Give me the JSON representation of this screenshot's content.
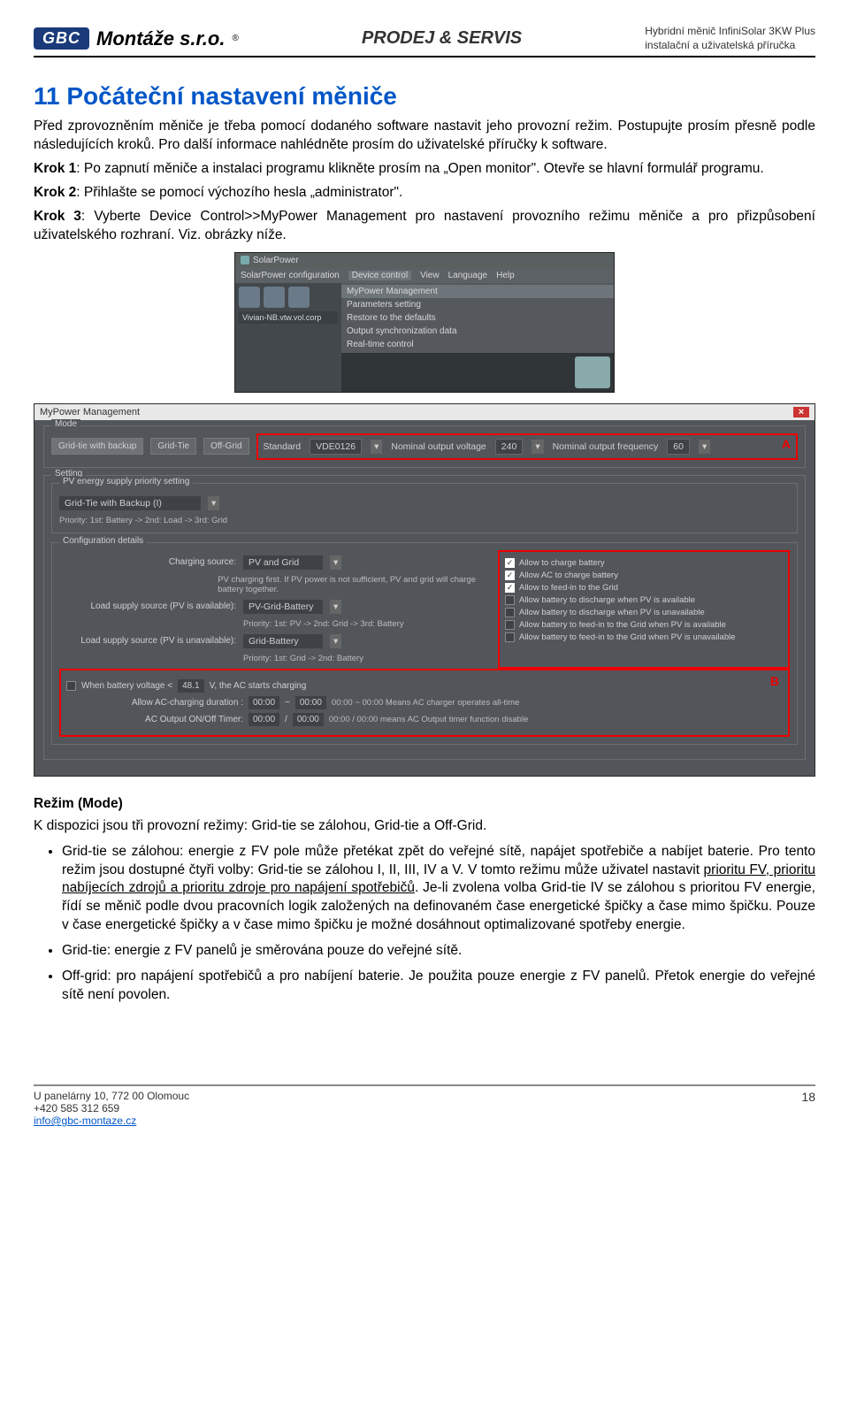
{
  "header": {
    "logo": "GBC",
    "company": "Montáže s.r.o.",
    "reg": "®",
    "mid": "PRODEJ & SERVIS",
    "right1": "Hybridní měnič InfiniSolar 3KW Plus",
    "right2": "instalační a uživatelská příručka"
  },
  "title": "11 Počáteční nastavení měniče",
  "intro": "Před zprovozněním měniče je třeba pomocí dodaného software nastavit jeho provozní režim. Postupujte prosím přesně podle následujících kroků. Pro další informace nahlédněte prosím do uživatelské příručky k software.",
  "krok1_b": "Krok 1",
  "krok1": ": Po zapnutí měniče a instalaci programu klikněte prosím na „Open monitor\". Otevře se hlavní formulář programu.",
  "krok2_b": "Krok 2",
  "krok2": ": Přihlašte se pomocí výchozího hesla „administrator\".",
  "krok3_b": "Krok 3",
  "krok3": ": Vyberte Device Control>>MyPower Management pro nastavení provozního režimu měniče a pro přizpůsobení uživatelského rozhraní. Viz. obrázky níže.",
  "ss1": {
    "appname": "SolarPower",
    "menu": [
      "SolarPower configuration",
      "Device control",
      "View",
      "Language",
      "Help"
    ],
    "treeitem": "Vivian-NB.vtw.vol.corp",
    "submenu": [
      "MyPower Management",
      "Parameters setting",
      "Restore to the defaults",
      "Output synchronization data",
      "Real-time control"
    ]
  },
  "ss2": {
    "winTitle": "MyPower Management",
    "mode": "Mode",
    "tabs": [
      "Grid-tie with backup",
      "Grid-Tie",
      "Off-Grid"
    ],
    "standard": "Standard",
    "standardVal": "VDE0126",
    "nov": "Nominal output voltage",
    "novVal": "240",
    "nof": "Nominal output frequency",
    "nofVal": "60",
    "letterA": "A",
    "setting": "Setting",
    "pvGroup": "PV energy supply priority setting",
    "pvOption": "Grid-Tie with Backup (I)",
    "pvPriority": "Priority: 1st: Battery -> 2nd: Load -> 3rd: Grid",
    "cfgGroup": "Configuration details",
    "chargingSource": "Charging source:",
    "chargingSourceVal": "PV and Grid",
    "chargingNote": "PV charging first. If PV power is not sufficient, PV and grid will charge battery together.",
    "loadAvail": "Load supply source (PV is available):",
    "loadAvailVal": "PV-Grid-Battery",
    "loadAvailNote": "Priority: 1st: PV -> 2nd: Grid -> 3rd: Battery",
    "loadUnavail": "Load supply source (PV is unavailable):",
    "loadUnavailVal": "Grid-Battery",
    "loadUnavailNote": "Priority: 1st: Grid -> 2nd: Battery",
    "checks": [
      {
        "checked": true,
        "label": "Allow to charge battery"
      },
      {
        "checked": true,
        "label": "Allow AC to charge battery"
      },
      {
        "checked": true,
        "label": "Allow to feed-in to the Grid"
      },
      {
        "checked": false,
        "label": "Allow battery to discharge when PV is available"
      },
      {
        "checked": false,
        "label": "Allow battery to discharge when PV is unavailable"
      },
      {
        "checked": false,
        "label": "Allow battery to feed-in to the Grid when PV is available"
      },
      {
        "checked": false,
        "label": "Allow battery to feed-in to the Grid when PV is unavailable"
      }
    ],
    "letterB": "B",
    "whenBatt": "When battery voltage <",
    "whenBattVal": "48.1",
    "whenBattUnit": "V,   the AC starts charging",
    "acDur": "Allow AC-charging duration :",
    "acDurFrom": "00:00",
    "acDurTo": "00:00",
    "acDurNote": "00:00 ~ 00:00 Means AC charger operates all-time",
    "acTimer": "AC Output ON/Off Timer:",
    "acTimerFrom": "00:00",
    "acTimerTo": "00:00",
    "acTimerNote": "00:00 / 00:00 means AC Output timer function disable"
  },
  "mode_heading": "Režim (Mode)",
  "mode_intro": "K dispozici jsou tři provozní režimy: Grid-tie se zálohou, Grid-tie a Off-Grid.",
  "mode_items": [
    "Grid-tie se zálohou: energie z FV pole může přetékat zpět do veřejné sítě, napájet spotřebiče a nabíjet baterie. Pro tento režim jsou dostupné čtyři volby: Grid-tie se zálohou I, II, III, IV a V. V tomto režimu může uživatel nastavit ",
    "prioritu FV, prioritu nabíjecích zdrojů a prioritu zdroje pro napájení spotřebičů",
    ". Je-li zvolena volba Grid-tie IV se zálohou s prioritou FV energie, řídí se měnič podle dvou pracovních logik založených na definovaném čase energetické špičky a čase mimo špičku. Pouze v čase energetické špičky a v čase mimo špičku je možné dosáhnout optimalizované spotřeby energie.",
    "Grid-tie: energie z FV panelů je směrována pouze do veřejné sítě.",
    "Off-grid: pro napájení spotřebičů a pro nabíjení baterie. Je použita pouze energie z FV panelů. Přetok energie do veřejné sítě není povolen."
  ],
  "footer": {
    "addr1": "U panelárny 10, 772 00 Olomouc",
    "addr2": "+420 585 312 659",
    "email": "info@gbc-montaze.cz",
    "page": "18"
  }
}
